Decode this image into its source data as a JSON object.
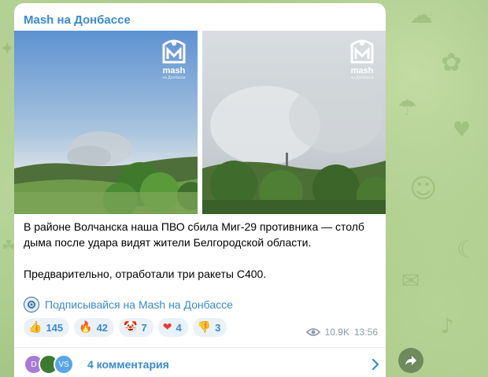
{
  "channel": {
    "title": "Mash на Донбассе"
  },
  "photos": [
    {
      "watermark": "mash",
      "sub": "на Донбассе",
      "icon": "mash-logo-icon"
    },
    {
      "watermark": "mash",
      "sub": "на Донбассе",
      "icon": "mash-logo-icon"
    }
  ],
  "caption": {
    "paragraph1": "В районе Волчанска наша ПВО сбила Миг-29 противника — столб дыма после удара видят жители Белгородской области.",
    "paragraph2": "Предварительно, отработали три ракеты С400."
  },
  "subscribe": {
    "label": "Подписывайся на Mash на Донбассе",
    "icon": "channel-icon"
  },
  "reactions": [
    {
      "emoji": "👍",
      "count": "145",
      "icon": "thumbs-up-icon"
    },
    {
      "emoji": "🔥",
      "count": "42",
      "icon": "fire-icon"
    },
    {
      "emoji": "🤡",
      "count": "7",
      "icon": "clown-icon"
    },
    {
      "emoji": "❤",
      "count": "4",
      "icon": "heart-icon"
    },
    {
      "emoji": "👎",
      "count": "3",
      "icon": "thumbs-down-icon"
    }
  ],
  "meta": {
    "views": "10.9K",
    "time": "13:56"
  },
  "comments": {
    "label": "4 комментария",
    "avatars": [
      "D",
      "",
      "VS"
    ]
  },
  "colors": {
    "accent": "#3a8ad0",
    "bubble": "#ffffff",
    "background": "#a9c98f"
  }
}
